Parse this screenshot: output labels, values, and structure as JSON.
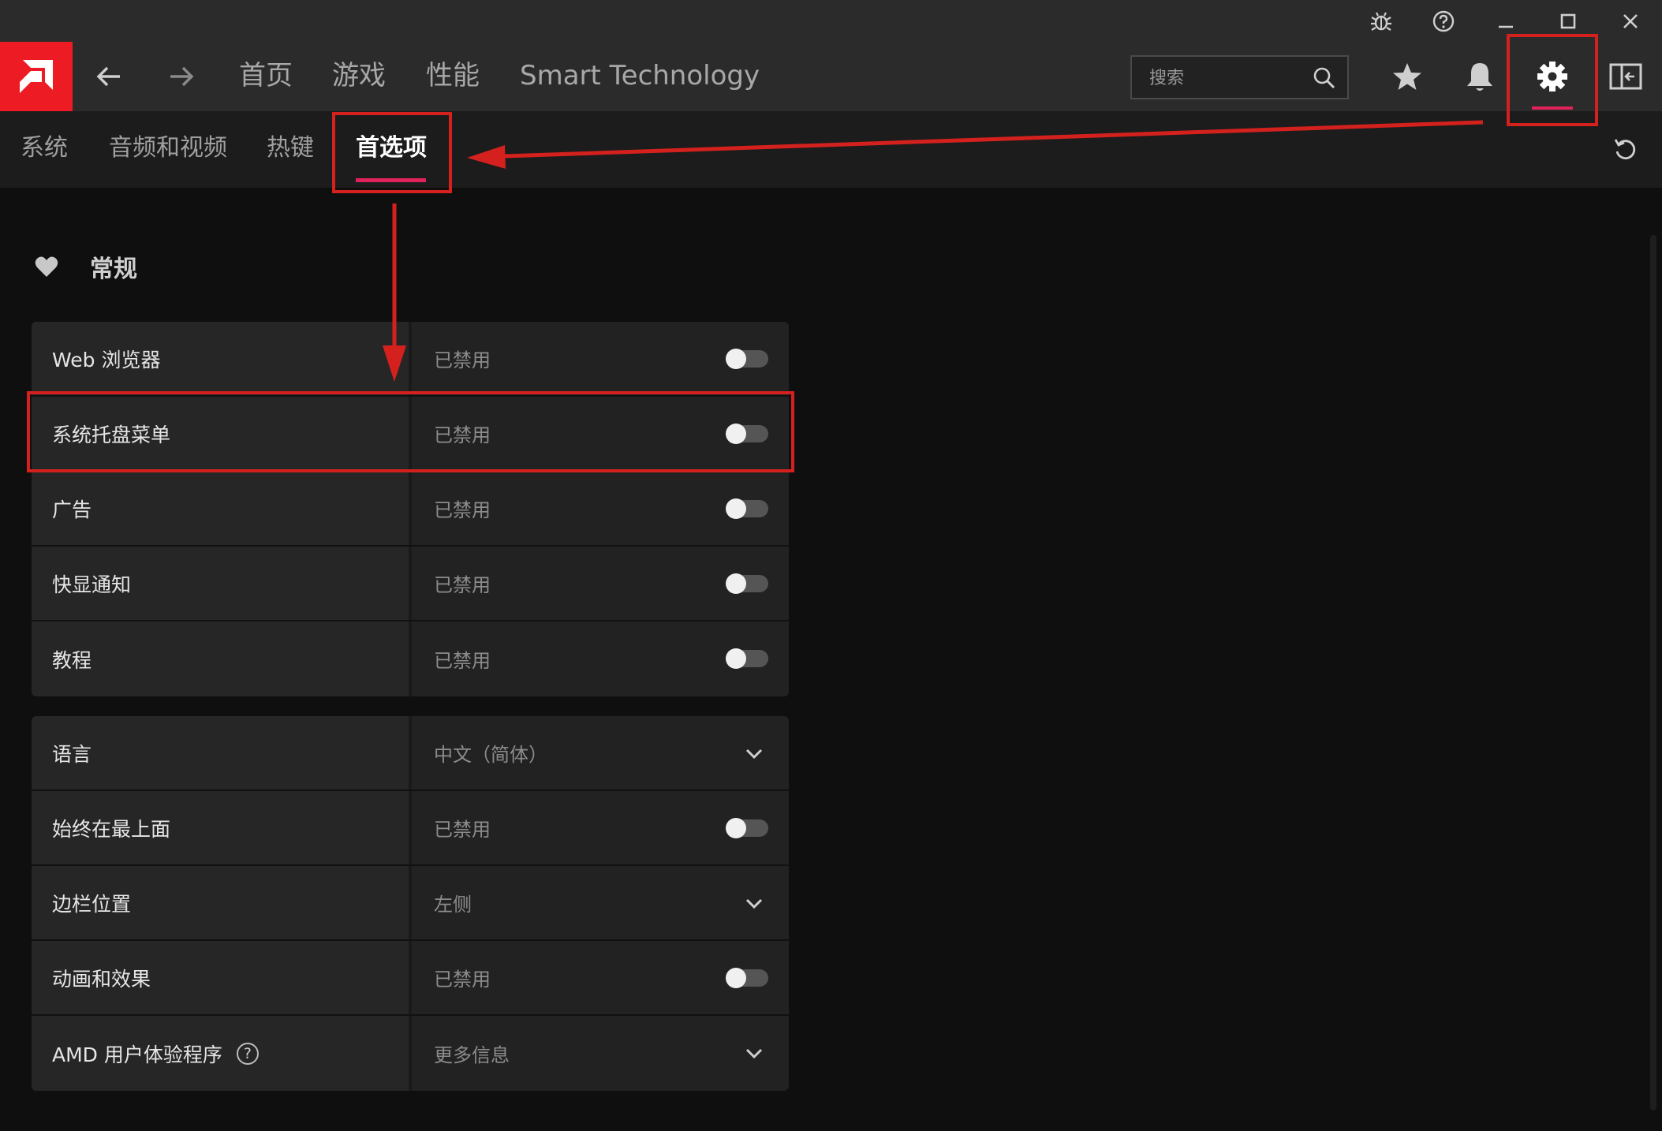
{
  "colors": {
    "brand": "#ed1c24",
    "accent": "#e0225a",
    "annotation": "#d4211e"
  },
  "titlebar": {
    "icons": [
      "bug-icon",
      "help-circle-icon",
      "minimize-icon",
      "maximize-icon",
      "close-icon"
    ]
  },
  "nav": {
    "links": [
      "首页",
      "游戏",
      "性能",
      "Smart Technology"
    ],
    "search_placeholder": "搜索",
    "icons": [
      "star-icon",
      "bell-icon",
      "gear-icon",
      "sidebar-toggle-icon"
    ]
  },
  "subtabs": {
    "items": [
      "系统",
      "音频和视频",
      "热键",
      "首选项"
    ],
    "active": "首选项"
  },
  "section": {
    "title": "常规"
  },
  "group1": [
    {
      "label": "Web 浏览器",
      "value": "已禁用",
      "control": "toggle",
      "on": false
    },
    {
      "label": "系统托盘菜单",
      "value": "已禁用",
      "control": "toggle",
      "on": false
    },
    {
      "label": "广告",
      "value": "已禁用",
      "control": "toggle",
      "on": false
    },
    {
      "label": "快显通知",
      "value": "已禁用",
      "control": "toggle",
      "on": false
    },
    {
      "label": "教程",
      "value": "已禁用",
      "control": "toggle",
      "on": false
    }
  ],
  "group2": [
    {
      "label": "语言",
      "value": "中文（简体）",
      "control": "dropdown"
    },
    {
      "label": "始终在最上面",
      "value": "已禁用",
      "control": "toggle",
      "on": false
    },
    {
      "label": "边栏位置",
      "value": "左侧",
      "control": "dropdown"
    },
    {
      "label": "动画和效果",
      "value": "已禁用",
      "control": "toggle",
      "on": false
    },
    {
      "label": "AMD 用户体验程序",
      "value": "更多信息",
      "control": "dropdown",
      "help": "?"
    }
  ]
}
